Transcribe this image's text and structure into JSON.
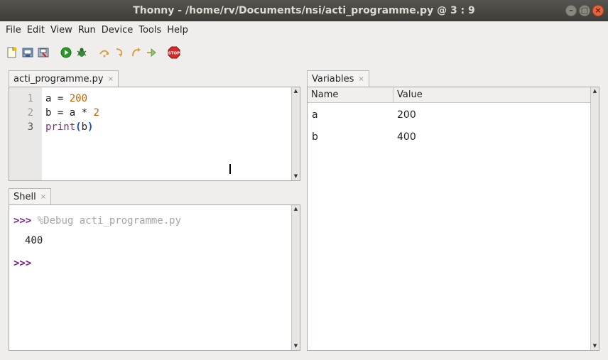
{
  "window": {
    "title": "Thonny  -  /home/rv/Documents/nsi/acti_programme.py  @  3 : 9",
    "buttons": [
      "–",
      "□",
      "×"
    ]
  },
  "menu": [
    "File",
    "Edit",
    "View",
    "Run",
    "Device",
    "Tools",
    "Help"
  ],
  "toolbar": {
    "icons": [
      "new-file-icon",
      "open-file-icon",
      "save-file-icon",
      "run-icon",
      "debug-icon",
      "step-over-icon",
      "step-into-icon",
      "step-out-icon",
      "resume-icon",
      "stop-icon"
    ],
    "stop_label": "STOP",
    "colors": {
      "run": "#2a9a2a",
      "stop": "#d42a2a"
    }
  },
  "editor": {
    "tab_label": "acti_programme.py",
    "tab_close": "×",
    "lines": [
      {
        "n": "1",
        "tokens": [
          {
            "t": "a = ",
            "c": "plain"
          },
          {
            "t": "200",
            "c": "num"
          }
        ]
      },
      {
        "n": "2",
        "tokens": [
          {
            "t": "b = a * ",
            "c": "plain"
          },
          {
            "t": "2",
            "c": "num"
          }
        ]
      },
      {
        "n": "3",
        "tokens": [
          {
            "t": "print",
            "c": "kw"
          },
          {
            "t": "(",
            "c": "paren"
          },
          {
            "t": "b",
            "c": "plain"
          },
          {
            "t": ")",
            "c": "paren"
          }
        ]
      }
    ]
  },
  "shell": {
    "tab_label": "Shell",
    "tab_close": "×",
    "prompt": ">>>",
    "command": "%Debug acti_programme.py",
    "output": "400"
  },
  "variables": {
    "tab_label": "Variables",
    "tab_close": "×",
    "columns": [
      "Name",
      "Value"
    ],
    "rows": [
      {
        "name": "a",
        "value": "200"
      },
      {
        "name": "b",
        "value": "400"
      }
    ]
  }
}
